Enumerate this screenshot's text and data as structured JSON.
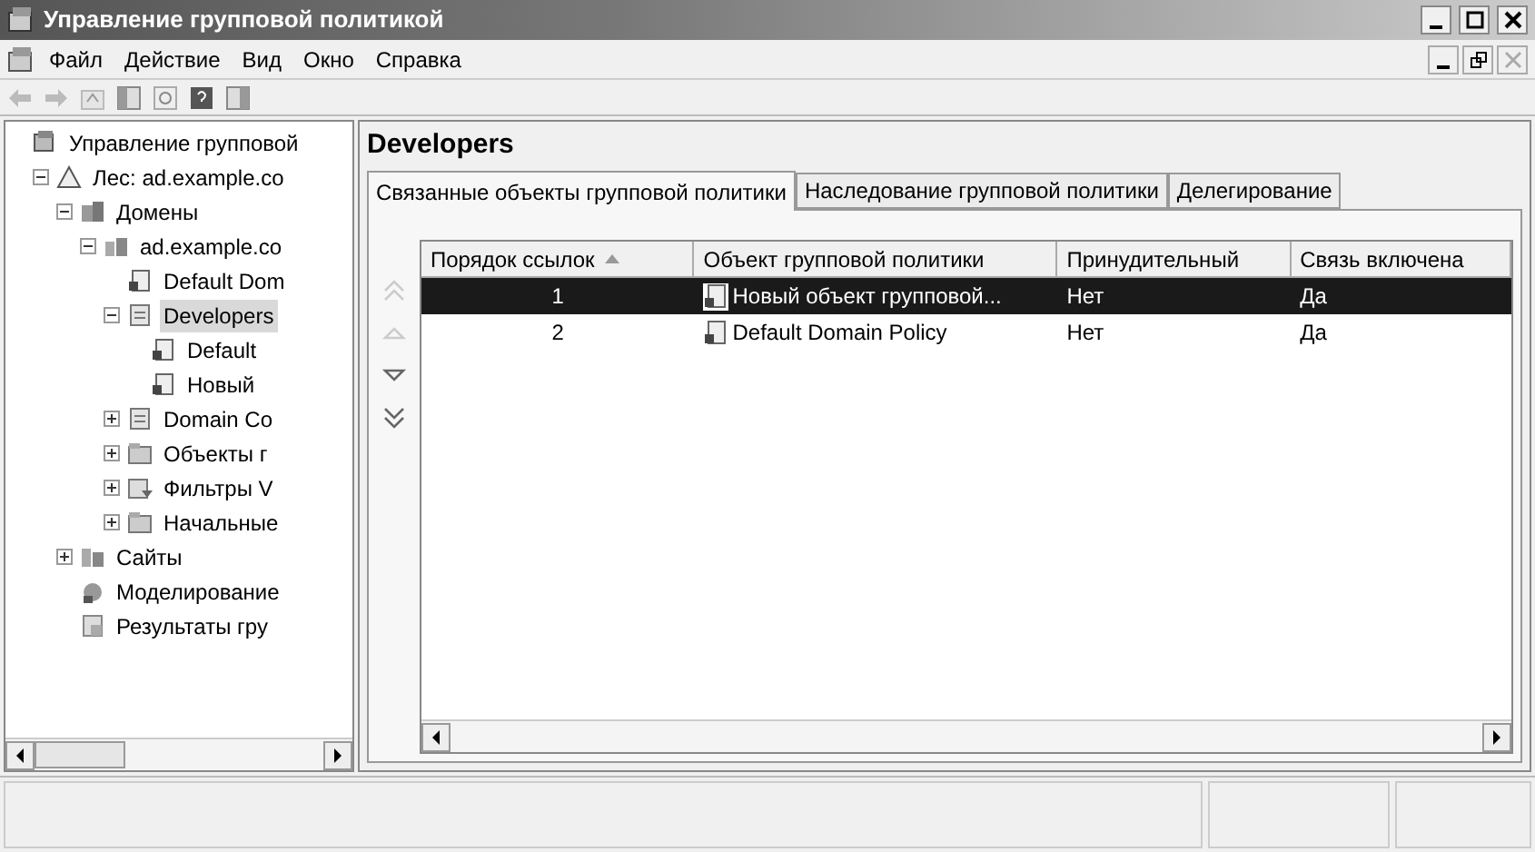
{
  "window": {
    "title": "Управление групповой политикой"
  },
  "menu": [
    "Файл",
    "Действие",
    "Вид",
    "Окно",
    "Справка"
  ],
  "tree": [
    {
      "label": "Управление групповой",
      "kind": "console",
      "selected": false,
      "children": [
        {
          "label": "Лес: ad.example.co",
          "kind": "forest",
          "selected": false,
          "expanded": true,
          "children": [
            {
              "label": "Домены",
              "kind": "domains",
              "selected": false,
              "expanded": true,
              "children": [
                {
                  "label": "ad.example.co",
                  "kind": "domain",
                  "selected": false,
                  "expanded": true,
                  "children": [
                    {
                      "label": "Default Dom",
                      "kind": "link",
                      "selected": false
                    },
                    {
                      "label": "Developers",
                      "kind": "ou",
                      "selected": true,
                      "expanded": true,
                      "children": [
                        {
                          "label": "Default",
                          "kind": "link",
                          "selected": false
                        },
                        {
                          "label": "Новый",
                          "kind": "link",
                          "selected": false
                        }
                      ]
                    },
                    {
                      "label": "Domain Co",
                      "kind": "ou",
                      "selected": false,
                      "expanded": false
                    },
                    {
                      "label": "Объекты г",
                      "kind": "folder",
                      "selected": false,
                      "expanded": false
                    },
                    {
                      "label": "Фильтры V",
                      "kind": "filter",
                      "selected": false,
                      "expanded": false
                    },
                    {
                      "label": "Начальные",
                      "kind": "folder",
                      "selected": false,
                      "expanded": false
                    }
                  ]
                }
              ]
            },
            {
              "label": "Сайты",
              "kind": "sites",
              "selected": false,
              "expanded": false
            },
            {
              "label": "Моделирование",
              "kind": "modeling",
              "selected": false
            },
            {
              "label": "Результаты гру",
              "kind": "results",
              "selected": false
            }
          ]
        }
      ]
    }
  ],
  "pane": {
    "title": "Developers",
    "tabs": [
      {
        "label": "Связанные объекты групповой политики",
        "selected": true
      },
      {
        "label": "Наследование групповой политики",
        "selected": false
      },
      {
        "label": "Делегирование",
        "selected": false
      }
    ],
    "order_buttons": [
      {
        "kind": "top",
        "disabled": true
      },
      {
        "kind": "up",
        "disabled": true
      },
      {
        "kind": "down",
        "disabled": false
      },
      {
        "kind": "bottom",
        "disabled": false
      }
    ],
    "table": {
      "columns": [
        {
          "label": "Порядок ссылок",
          "sorted": true
        },
        {
          "label": "Объект групповой политики",
          "sorted": false
        },
        {
          "label": "Принудительный",
          "sorted": false
        },
        {
          "label": "Связь включена",
          "sorted": false
        }
      ],
      "rows": [
        {
          "selected": true,
          "cells": [
            "1",
            "Новый объект групповой...",
            "Нет",
            "Да"
          ]
        },
        {
          "selected": false,
          "cells": [
            "2",
            "Default Domain Policy",
            "Нет",
            "Да"
          ]
        }
      ]
    }
  }
}
